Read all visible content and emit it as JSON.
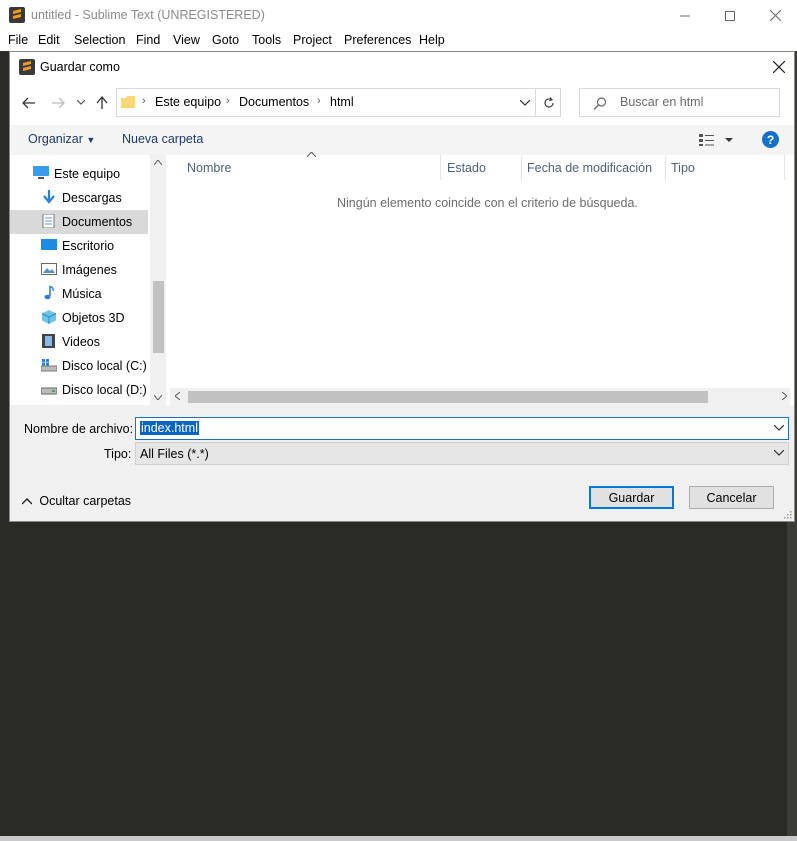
{
  "app": {
    "title": "untitled - Sublime Text (UNREGISTERED)",
    "menu": [
      "File",
      "Edit",
      "Selection",
      "Find",
      "View",
      "Goto",
      "Tools",
      "Project",
      "Preferences",
      "Help"
    ]
  },
  "dialog": {
    "title": "Guardar como",
    "breadcrumb": [
      "Este equipo",
      "Documentos",
      "html"
    ],
    "search_placeholder": "Buscar en html",
    "toolbar": {
      "organize": "Organizar",
      "new_folder": "Nueva carpeta"
    },
    "nav_items": [
      "Este equipo",
      "Descargas",
      "Documentos",
      "Escritorio",
      "Imágenes",
      "Música",
      "Objetos 3D",
      "Videos",
      "Disco local (C:)",
      "Disco local (D:)"
    ],
    "selected_nav": "Documentos",
    "columns": [
      "Nombre",
      "Estado",
      "Fecha de modificación",
      "Tipo"
    ],
    "empty_message": "Ningún elemento coincide con el criterio de búsqueda.",
    "filename_label": "Nombre de archivo:",
    "filename_value": "index.html",
    "type_label": "Tipo:",
    "type_value": "All Files (*.*)",
    "hide_folders": "Ocultar carpetas",
    "save_button": "Guardar",
    "cancel_button": "Cancelar"
  },
  "icons": {
    "help": "?",
    "accent": "#0078d7"
  }
}
